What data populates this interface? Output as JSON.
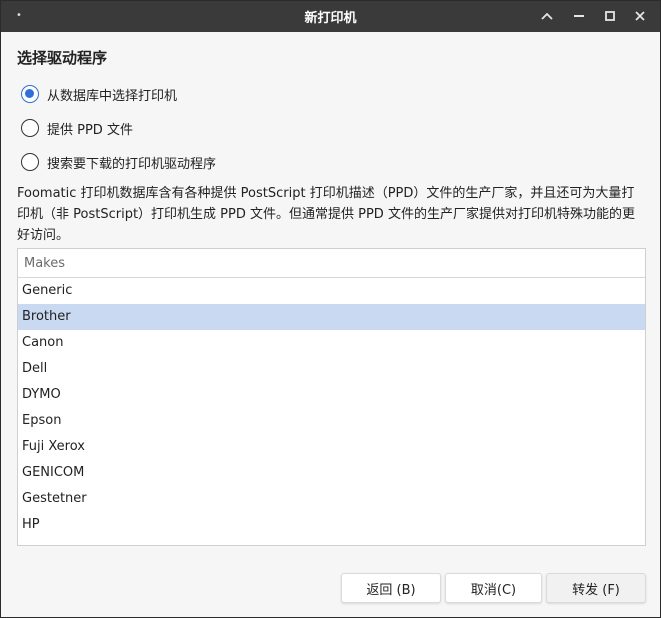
{
  "window": {
    "title": "新打印机",
    "menu_icon": "•",
    "controls": [
      "collapse",
      "minimize",
      "maximize",
      "close"
    ]
  },
  "section_title": "选择驱动程序",
  "options": [
    {
      "label": "从数据库中选择打印机",
      "checked": true
    },
    {
      "label": "提供 PPD 文件",
      "checked": false
    },
    {
      "label": "搜索要下载的打印机驱动程序",
      "checked": false
    }
  ],
  "description": "Foomatic 打印机数据库含有各种提供 PostScript 打印机描述（PPD）文件的生产厂家，并且还可为大量打印机（非 PostScript）打印机生成 PPD 文件。但通常提供 PPD 文件的生产厂家提供对打印机特殊功能的更好访问。",
  "makes": {
    "header": "Makes",
    "items": [
      "Generic",
      "Brother",
      "Canon",
      "Dell",
      "DYMO",
      "Epson",
      "Fuji Xerox",
      "GENICOM",
      "Gestetner",
      "HP"
    ],
    "selected_index": 1
  },
  "buttons": {
    "back": "返回 (B)",
    "cancel": "取消(C)",
    "forward": "转发 (F)"
  },
  "colors": {
    "accent": "#2f6fd6",
    "selection": "#c9d9f2",
    "titlebar": "#3a3a3a"
  }
}
